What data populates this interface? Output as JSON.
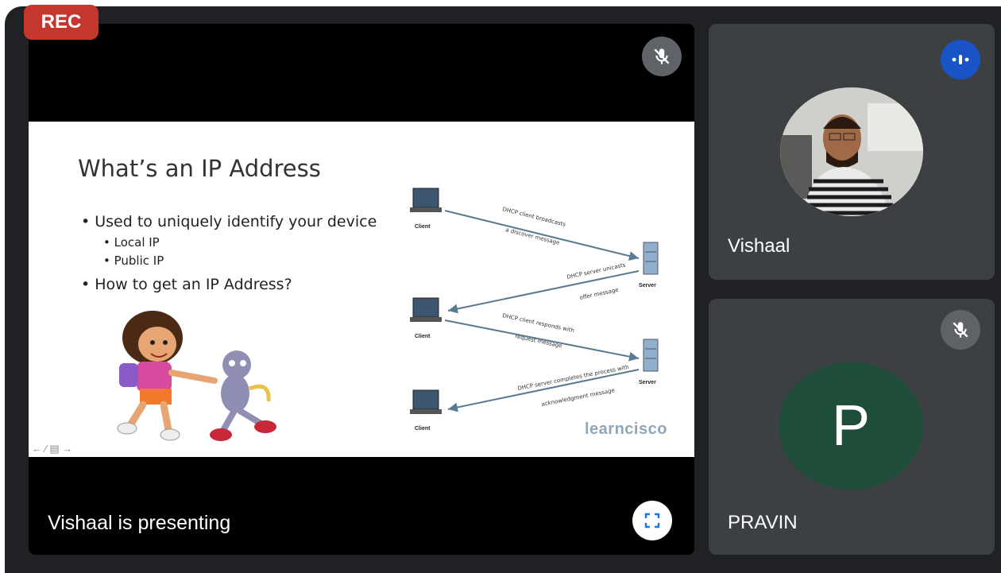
{
  "recording": {
    "label": "REC"
  },
  "presentation": {
    "presenting_label": "Vishaal is presenting",
    "slide": {
      "title": "What’s an IP Address",
      "bullets": {
        "b1": "• Used to uniquely identify your device",
        "b2": "• Local IP",
        "b3": "• Public IP",
        "b4": "• How to get an IP Address?"
      },
      "diagram": {
        "client_label": "Client",
        "server_label": "Server",
        "steps": [
          {
            "line1": "DHCP client broadcasts",
            "line2": "a discover message"
          },
          {
            "line1": "DHCP server unicasts",
            "line2": "offer message"
          },
          {
            "line1": "DHCP client responds with",
            "line2": "request message"
          },
          {
            "line1": "DHCP server completes the process with",
            "line2": "acknowledgment message"
          }
        ]
      },
      "watermark": "learncisco",
      "nav_symbols": "← ∕ ▤ →"
    }
  },
  "participants": [
    {
      "name": "Vishaal",
      "status": "speaking"
    },
    {
      "name": "PRAVIN",
      "initial": "P",
      "status": "muted",
      "avatar_color": "#1e4d3a"
    }
  ],
  "colors": {
    "rec": "#c5372c",
    "speaking": "#1a53c6",
    "tile": "#3c4043",
    "background": "#202124"
  }
}
